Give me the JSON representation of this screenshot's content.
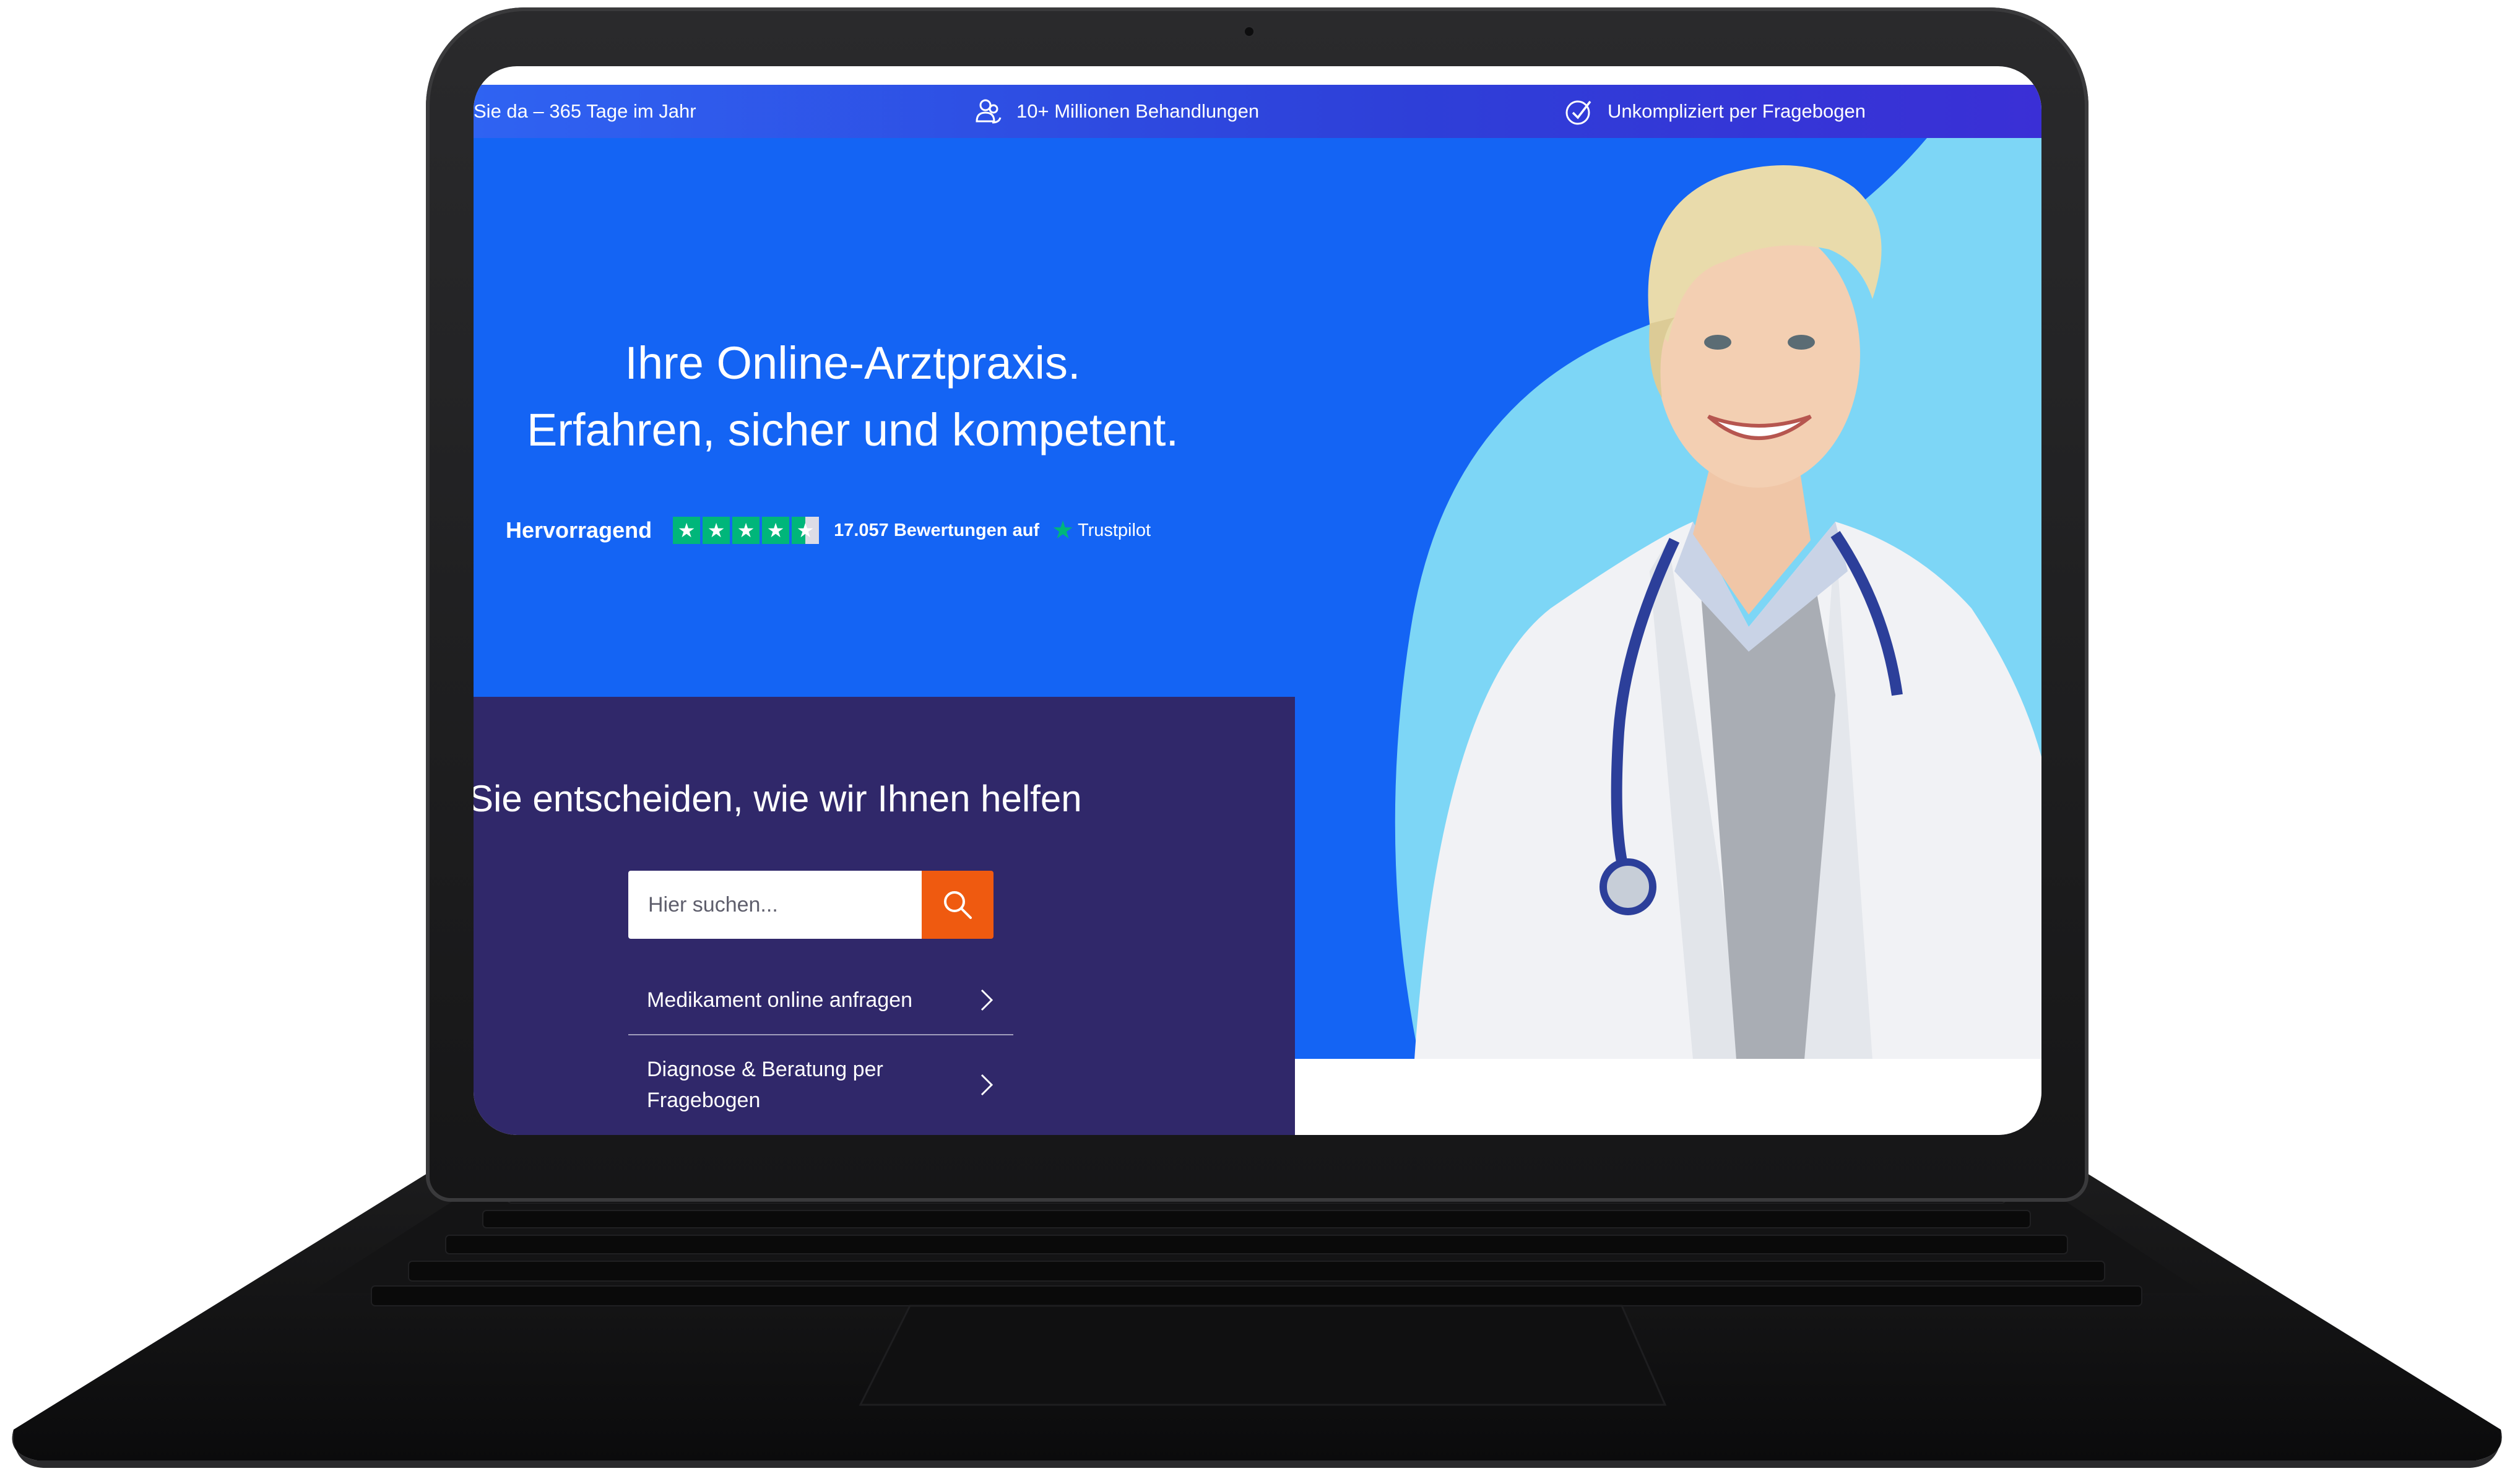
{
  "topbar": {
    "item1": "Sie da – 365 Tage im Jahr",
    "item2": "10+ Millionen Behandlungen",
    "item3": "Unkompliziert per Fragebogen"
  },
  "hero": {
    "headline_line1": "Ihre Online-Arztpraxis.",
    "headline_line2": "Erfahren, sicher und kompetent."
  },
  "trustpilot": {
    "rating_word": "Hervorragend",
    "stars_rating": 4.5,
    "reviews": "17.057 Bewertungen auf",
    "brand": "Trustpilot"
  },
  "card": {
    "title": "Sie entscheiden, wie wir Ihnen helfen",
    "search_placeholder": "Hier suchen...",
    "menu": [
      {
        "label": "Medikament online anfragen"
      },
      {
        "label": "Diagnose & Beratung per Fragebogen"
      }
    ]
  },
  "colors": {
    "hero_blue": "#1464f4",
    "blob_light_blue": "#7dd6f6",
    "card_purple": "#30286a",
    "search_orange": "#ef5a10",
    "trustpilot_green": "#00b67a"
  },
  "icons": [
    "users-icon",
    "checkmark-icon",
    "search-icon",
    "chevron-right-icon",
    "star-icon"
  ]
}
